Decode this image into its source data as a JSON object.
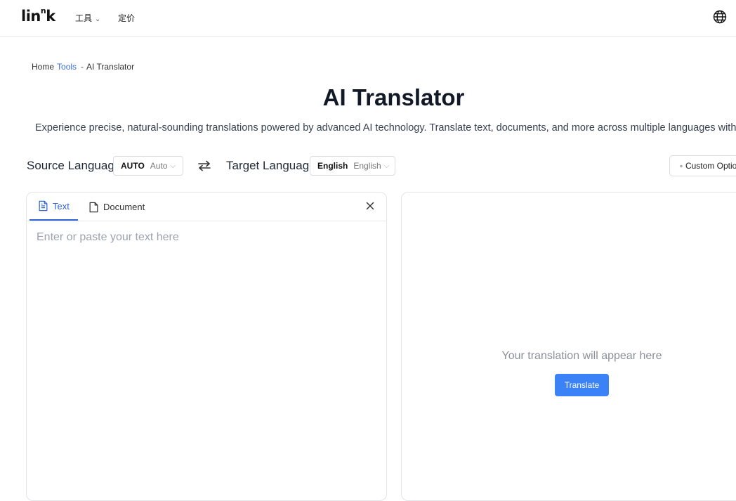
{
  "nav": {
    "logo_main": "lin",
    "logo_sup": "n",
    "logo_end": "k",
    "tools_label": "工具",
    "pricing_label": "定价",
    "language_icon": "globe-icon"
  },
  "breadcrumb": {
    "home": "Home",
    "tools": "Tools",
    "separator": "-",
    "current": "AI Translator"
  },
  "hero": {
    "title": "AI Translator",
    "subtitle": "Experience precise, natural-sounding translations powered by advanced AI technology. Translate text, documents, and more across multiple languages with just a few clicks."
  },
  "language_bar": {
    "source_label": "Source Language",
    "source_code": "AUTO",
    "source_name": "Auto",
    "swap_icon": "swap-arrows-icon",
    "target_label": "Target Language",
    "target_code": "English",
    "target_name": "English",
    "custom_options_label": "Custom Options",
    "custom_options_icon": "gear-icon"
  },
  "input_panel": {
    "tabs": [
      {
        "label": "Text",
        "icon": "file-text-icon",
        "active": true
      },
      {
        "label": "Document",
        "icon": "file-icon",
        "active": false
      }
    ],
    "placeholder": "Enter or paste your text here",
    "value": ""
  },
  "output_panel": {
    "placeholder": "Your translation will appear here",
    "translate_label": "Translate"
  },
  "colors": {
    "accent": "#3b82f6",
    "link": "#3b6fd8",
    "border": "#e3e5e8"
  }
}
